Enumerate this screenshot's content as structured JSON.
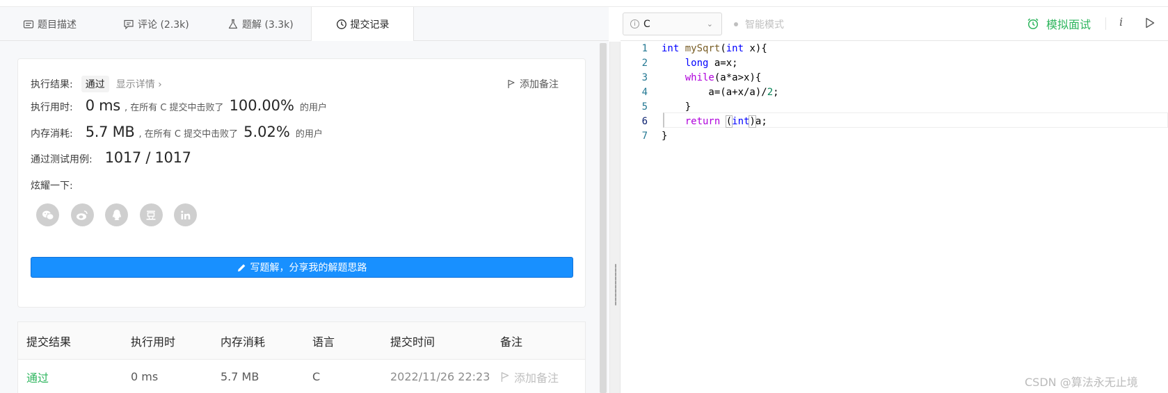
{
  "tabs": [
    {
      "label": "题目描述",
      "icon": "description-icon"
    },
    {
      "label": "评论 (2.3k)",
      "icon": "comment-icon"
    },
    {
      "label": "题解 (3.3k)",
      "icon": "flask-icon"
    },
    {
      "label": "提交记录",
      "icon": "clock-icon",
      "active": true
    }
  ],
  "result": {
    "exec_result_label": "执行结果:",
    "status": "通过",
    "show_detail": "显示详情 ›",
    "add_note": "添加备注",
    "time_label": "执行用时:",
    "time_value": "0 ms",
    "time_beat_text": ", 在所有 C 提交中击败了",
    "time_percent": "100.00%",
    "time_users": "的用户",
    "memory_label": "内存消耗:",
    "memory_value": "5.7 MB",
    "memory_beat_text": ", 在所有 C 提交中击败了",
    "memory_percent": "5.02%",
    "memory_users": "的用户",
    "testcase_label": "通过测试用例:",
    "testcase_value": "1017 / 1017",
    "share_label": "炫耀一下:",
    "share_icons": [
      "wechat-icon",
      "weibo-icon",
      "qq-icon",
      "douban-icon",
      "linkedin-icon"
    ],
    "write_solution": "写题解，分享我的解题思路"
  },
  "submissions": {
    "headers": [
      "提交结果",
      "执行用时",
      "内存消耗",
      "语言",
      "提交时间",
      "备注"
    ],
    "rows": [
      {
        "status": "通过",
        "time": "0 ms",
        "memory": "5.7 MB",
        "lang": "C",
        "submitted_at": "2022/11/26 22:23",
        "note": "添加备注"
      }
    ]
  },
  "toolbar": {
    "language": "C",
    "smart_mode": "智能模式",
    "mock_interview": "模拟面试",
    "info": "i"
  },
  "editor": {
    "lines": [
      "int mySqrt(int x){",
      "    long a=x;",
      "    while(a*a>x){",
      "        a=(a+x/a)/2;",
      "    }",
      "    return (int)a;",
      "}"
    ],
    "line_numbers": [
      "1",
      "2",
      "3",
      "4",
      "5",
      "6",
      "7"
    ]
  },
  "watermark": "CSDN @算法永无止境",
  "colors": {
    "accent_blue": "#1890ff",
    "pass_green": "#2db55d",
    "keyword_blue": "#0000ff"
  }
}
